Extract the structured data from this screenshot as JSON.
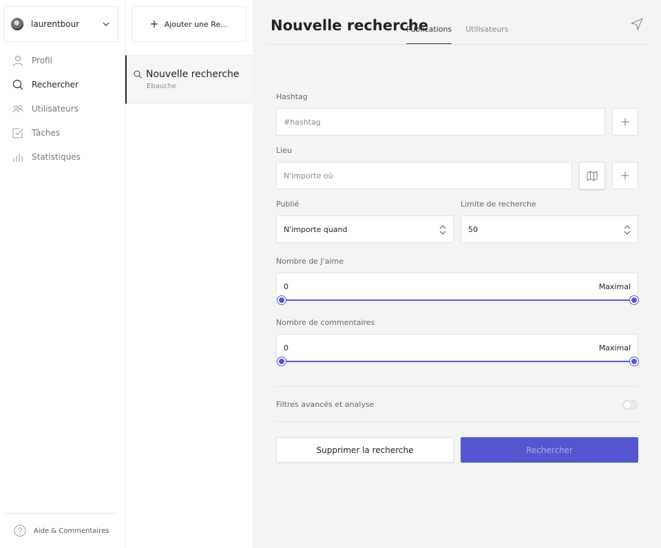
{
  "account": {
    "username": "laurentbour"
  },
  "nav": {
    "items": [
      {
        "label": "Profil",
        "icon": "user-icon"
      },
      {
        "label": "Rechercher",
        "icon": "search-icon",
        "active": true
      },
      {
        "label": "Utilisateurs",
        "icon": "users-icon"
      },
      {
        "label": "Tâches",
        "icon": "checkbox-icon"
      },
      {
        "label": "Statistiques",
        "icon": "bar-chart-icon"
      }
    ],
    "help_label": "Aide & Commentaires"
  },
  "searches": {
    "add_label": "Ajouter une Re...",
    "items": [
      {
        "title": "Nouvelle recherche",
        "status": "Ebauche"
      }
    ]
  },
  "main": {
    "title": "Nouvelle recherche",
    "tabs": [
      {
        "label": "Publications",
        "active": true
      },
      {
        "label": "Utilisateurs",
        "active": false
      }
    ],
    "hashtag": {
      "label": "Hashtag",
      "placeholder": "#hashtag"
    },
    "location": {
      "label": "Lieu",
      "placeholder": "N'importe où"
    },
    "published": {
      "label": "Publié",
      "value": "N'importe quand"
    },
    "limit": {
      "label": "Limite de recherche",
      "value": "50"
    },
    "likes": {
      "label": "Nombre de J'aime",
      "min": "0",
      "max": "Maximal"
    },
    "comments": {
      "label": "Nombre de commentaires",
      "min": "0",
      "max": "Maximal"
    },
    "advanced": {
      "label": "Filtres avancés et analyse",
      "enabled": false
    },
    "delete_label": "Supprimer la recherche",
    "search_label": "Rechercher"
  },
  "colors": {
    "accent": "#5457cf",
    "panel_bg": "#f4f4f5"
  }
}
